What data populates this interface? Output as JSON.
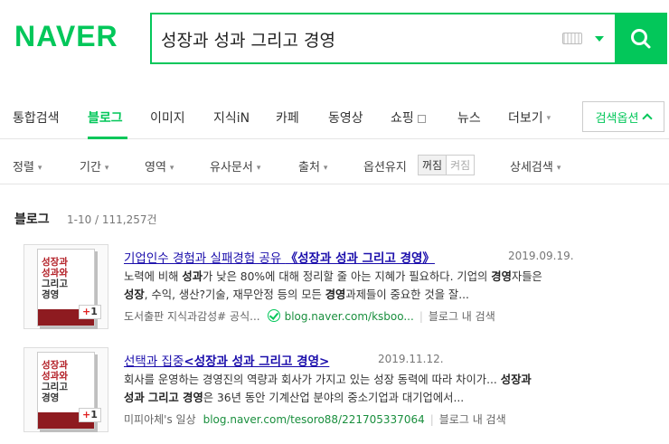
{
  "header": {
    "logo": "NAVER",
    "query": "성장과 성과 그리고 경영",
    "icons": [
      "keyboard-icon",
      "dropdown-caret-icon",
      "search-icon"
    ]
  },
  "tabs": [
    {
      "label": "통합검색"
    },
    {
      "label": "블로그",
      "active": true
    },
    {
      "label": "이미지"
    },
    {
      "label": "지식iN"
    },
    {
      "label": "카페"
    },
    {
      "label": "동영상"
    },
    {
      "label": "쇼핑"
    },
    {
      "label": "뉴스"
    },
    {
      "label": "더보기"
    }
  ],
  "search_option": "검색옵션",
  "filters": {
    "sort": "정렬",
    "period": "기간",
    "area": "영역",
    "similar": "유사문서",
    "source": "출처",
    "keep": "옵션유지",
    "keep_off": "꺼짐",
    "keep_on": "켜짐",
    "detail": "상세검색"
  },
  "section": {
    "title": "블로그",
    "count": "1-10 / 111,257건"
  },
  "results": [
    {
      "title_prefix": "기업인수 경험과 실패경험 공유 ",
      "title_bold": "《성장과 성과 그리고 경영》",
      "date": "2019.09.19.",
      "desc_1": "노력에 비해 ",
      "desc_b1": "성과",
      "desc_2": "가 낮은 80%에 대해 정리할 줄 아는 지혜가 필요하다. 기업의 ",
      "desc_b2": "경영",
      "desc_3": "자들은",
      "desc_b3": "성장",
      "desc_4": ", 수익, 생산?기술, 재무안정 등의 모든 ",
      "desc_b4": "경영",
      "desc_5": "과제들이 중요한 것을 잘...",
      "source": "도서출판 지식과감성# 공식...",
      "url": "blog.naver.com/ksboo...",
      "action": "블로그 내 검색",
      "thumb_title": [
        "성장과",
        "성과와",
        "그리고",
        "경영"
      ],
      "badge": "1"
    },
    {
      "title_prefix": "선택과 집중",
      "title_bold": "<성장과 성과 그리고 경영>",
      "date": "2019.11.12.",
      "desc_1": "회사를 운영하는 경영진의 역량과 회사가 가지고 있는 성장 동력에 따라 차이가... ",
      "desc_b1": "성장과",
      "desc_2": "",
      "desc_b2": "성과 그리고 경영",
      "desc_3": "은 36년 동안 기계산업 분야의 중소기업과 대기업에서...",
      "source": "미피아체's 일상",
      "url": "blog.naver.com/tesoro88/221705337064",
      "action": "블로그 내 검색",
      "thumb_title": [
        "성장과",
        "성과와",
        "그리고",
        "경영"
      ],
      "badge": "1"
    }
  ],
  "colors": {
    "brand": "#03c75a",
    "link": "#1a0dab",
    "url": "#1a8f3e"
  }
}
